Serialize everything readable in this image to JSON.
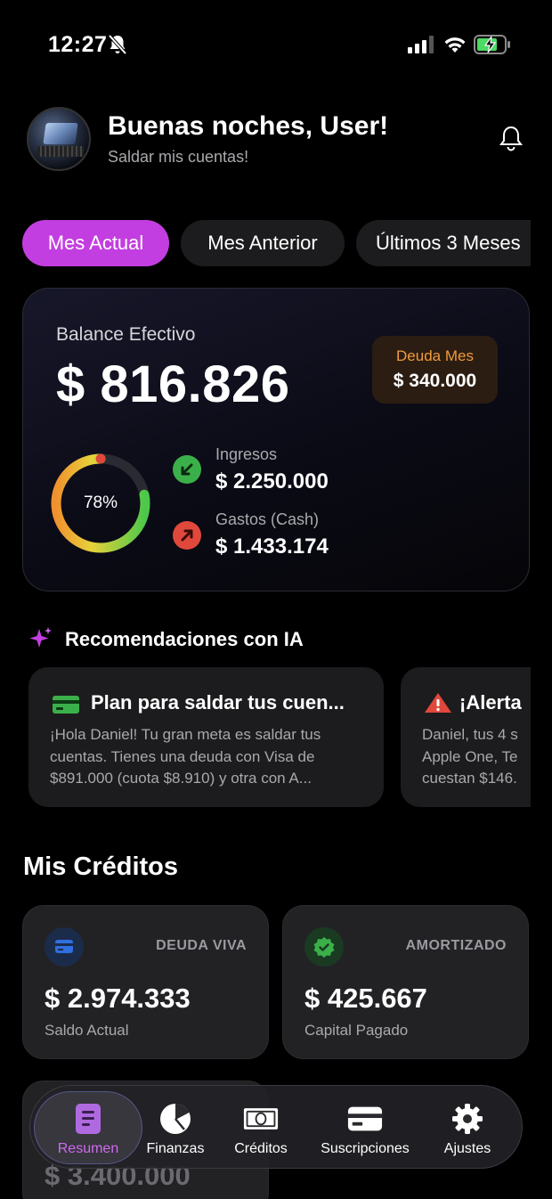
{
  "status_bar": {
    "time": "12:27"
  },
  "header": {
    "greeting": "Buenas noches, User!",
    "subtitle": "Saldar mis cuentas!"
  },
  "period_tabs": [
    {
      "label": "Mes Actual",
      "active": true
    },
    {
      "label": "Mes Anterior",
      "active": false
    },
    {
      "label": "Últimos 3 Meses",
      "active": false
    }
  ],
  "balance": {
    "label": "Balance Efectivo",
    "value": "$ 816.826",
    "debt_label": "Deuda Mes",
    "debt_value": "$ 340.000",
    "ratio_text": "78%",
    "ratio": 0.78,
    "income_label": "Ingresos",
    "income_value": "$ 2.250.000",
    "expense_label": "Gastos (Cash)",
    "expense_value": "$ 1.433.174"
  },
  "ai_section": {
    "title": "Recomendaciones con IA",
    "cards": [
      {
        "icon": "credit-card-icon",
        "title": "Plan para saldar tus cuen...",
        "body": "¡Hola Daniel! Tu gran meta es saldar tus cuentas. Tienes una deuda con Visa de $891.000 (cuota $8.910) y otra con A..."
      },
      {
        "icon": "warning-icon",
        "title": "¡Alerta",
        "body": "Daniel, tus 4 s Apple One, Te cuestan $146."
      }
    ]
  },
  "credits": {
    "title": "Mis Créditos",
    "cards": [
      {
        "icon": "card-icon",
        "tag": "DEUDA VIVA",
        "value": "$ 2.974.333",
        "sub": "Saldo Actual",
        "accent": "#2f6fe0"
      },
      {
        "icon": "check-badge-icon",
        "tag": "AMORTIZADO",
        "value": "$ 425.667",
        "sub": "Capital Pagado",
        "accent": "#3bb04a"
      }
    ],
    "partial_value": "$ 3.400.000"
  },
  "tab_bar": [
    {
      "label": "Resumen",
      "icon": "document-icon",
      "active": true
    },
    {
      "label": "Finanzas",
      "icon": "pie-chart-icon",
      "active": false
    },
    {
      "label": "Créditos",
      "icon": "banknote-icon",
      "active": false
    },
    {
      "label": "Suscripciones",
      "icon": "card-icon",
      "active": false
    },
    {
      "label": "Ajustes",
      "icon": "gear-icon",
      "active": false
    }
  ],
  "colors": {
    "accent": "#c33ee0",
    "income": "#3bb04a",
    "expense": "#e0483c",
    "debt": "#f09a3e"
  }
}
